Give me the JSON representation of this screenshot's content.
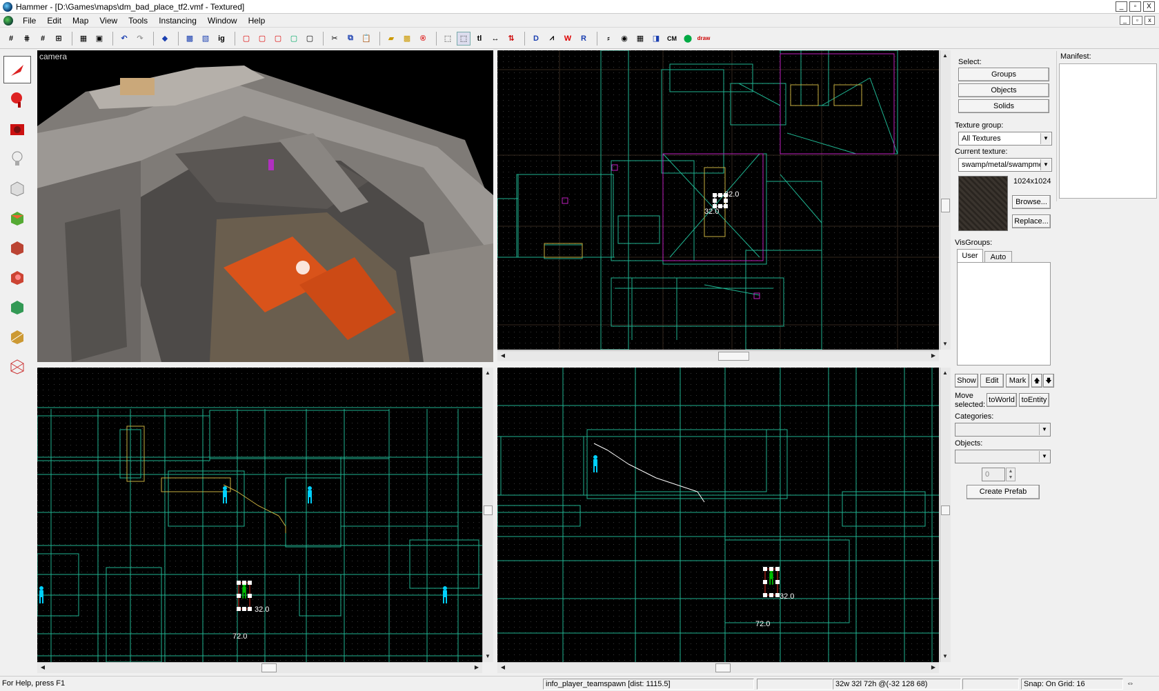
{
  "window": {
    "title": "Hammer - [D:\\Games\\maps\\dm_bad_place_tf2.vmf - Textured]",
    "controls": [
      "_",
      "▫",
      "X"
    ],
    "mdi_controls": [
      "_",
      "▫",
      "x"
    ]
  },
  "menu": [
    "File",
    "Edit",
    "Map",
    "View",
    "Tools",
    "Instancing",
    "Window",
    "Help"
  ],
  "toolbar": {
    "text_buttons": {
      "ig": "ig",
      "tl": "tl",
      "cm": "CM",
      "draw": "draw"
    }
  },
  "viewports": {
    "camera_label": "camera",
    "top_labels": {
      "w": "32.0",
      "h": "32.0"
    },
    "front_labels": {
      "w": "32.0",
      "h": "72.0"
    },
    "side_labels": {
      "w": "32.0",
      "h": "72.0"
    }
  },
  "panel": {
    "select_label": "Select:",
    "groups_button": "Groups",
    "objects_button": "Objects",
    "solids_button": "Solids",
    "texture_group_label": "Texture group:",
    "texture_group_value": "All Textures",
    "current_texture_label": "Current texture:",
    "current_texture_value": "swamp/metal/swampmetal",
    "texture_size": "1024x1024",
    "browse_button": "Browse...",
    "replace_button": "Replace...",
    "visgroups_label": "VisGroups:",
    "visgroup_tabs": [
      "User",
      "Auto"
    ],
    "show_button": "Show",
    "edit_button": "Edit",
    "mark_button": "Mark",
    "up_button": "🡅",
    "down_button": "🡇",
    "move_selected_label": "Move selected:",
    "to_world_button": "toWorld",
    "to_entity_button": "toEntity",
    "categories_label": "Categories:",
    "objects_label": "Objects:",
    "prefab_count": "0",
    "create_prefab_button": "Create Prefab"
  },
  "manifest_label": "Manifest:",
  "status": {
    "help": "For Help, press F1",
    "entity": "info_player_teamspawn   [dist: 1115.5]",
    "size": "32w 32l 72h @(-32 128 68)",
    "snap": "Snap: On Grid: 16"
  },
  "colors": {
    "grid_dot": "#3a3a3a",
    "brush_line": "#1fb592",
    "brush_line_light": "#8fd8c8",
    "selection": "#ffffff",
    "entity": "#00d0ff",
    "selected_entity": "#00c000",
    "lava": "#e0561a",
    "stone": "#8a8784",
    "magenta": "#c020c0",
    "yellow": "#c8b040"
  }
}
